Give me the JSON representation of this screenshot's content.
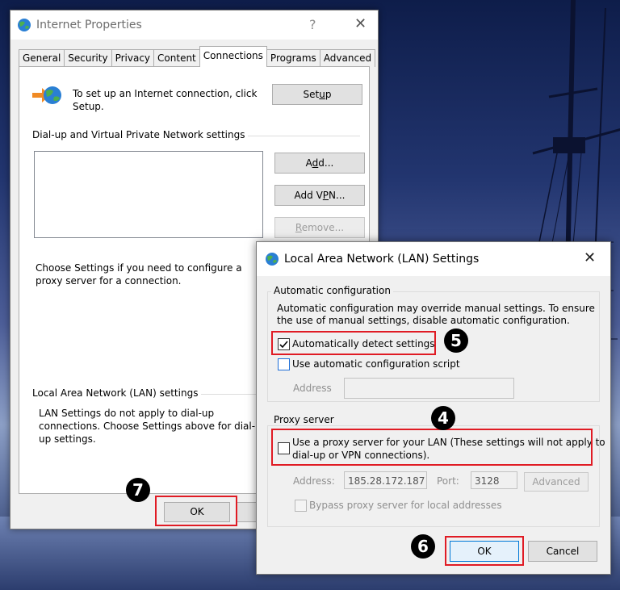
{
  "internet_properties": {
    "title": "Internet Properties",
    "help": "?",
    "close": "✕",
    "tabs": [
      "General",
      "Security",
      "Privacy",
      "Content",
      "Connections",
      "Programs",
      "Advanced"
    ],
    "active_tab": "Connections",
    "setup_text": "To set up an Internet connection, click Setup.",
    "setup_button": {
      "prefix": "Set",
      "mnemonic": "u",
      "suffix": "p"
    },
    "dialup_heading": "Dial-up and Virtual Private Network settings",
    "add_button": {
      "prefix": "A",
      "mnemonic": "d",
      "suffix": "d..."
    },
    "add_vpn_button": {
      "prefix": "Add V",
      "mnemonic": "P",
      "suffix": "N..."
    },
    "remove_button": {
      "prefix": "",
      "mnemonic": "R",
      "suffix": "emove..."
    },
    "choose_settings_text": "Choose Settings if you need to configure a proxy server for a connection.",
    "lan_heading": "Local Area Network (LAN) settings",
    "lan_text": "LAN Settings do not apply to dial-up connections. Choose Settings above for dial-up settings.",
    "ok_button": "OK"
  },
  "lan_settings": {
    "title": "Local Area Network (LAN) Settings",
    "close": "✕",
    "auto_config_group": "Automatic configuration",
    "auto_config_text": "Automatic configuration may override manual settings.  To ensure the use of manual settings, disable automatic configuration.",
    "auto_detect_label": "Automatically detect settings",
    "auto_detect_checked": true,
    "auto_script_label": "Use automatic configuration script",
    "auto_script_checked": false,
    "address_label": "Address",
    "script_address_value": "",
    "proxy_group": "Proxy server",
    "use_proxy_label_line1": "Use a proxy server for your LAN (These settings will not apply to",
    "use_proxy_label_line2": "dial-up or VPN connections).",
    "use_proxy_checked": false,
    "proxy_address_label": "Address:",
    "proxy_address_value": "185.28.172.187",
    "port_label": "Port:",
    "port_value": "3128",
    "advanced_button": "Advanced",
    "bypass_label": "Bypass proxy server for local addresses",
    "bypass_checked": false,
    "ok_button": "OK",
    "cancel_button": "Cancel"
  },
  "annotations": {
    "step4": "4",
    "step5": "5",
    "step6": "6",
    "step7": "7",
    "highlight_color": "#e01b24"
  }
}
